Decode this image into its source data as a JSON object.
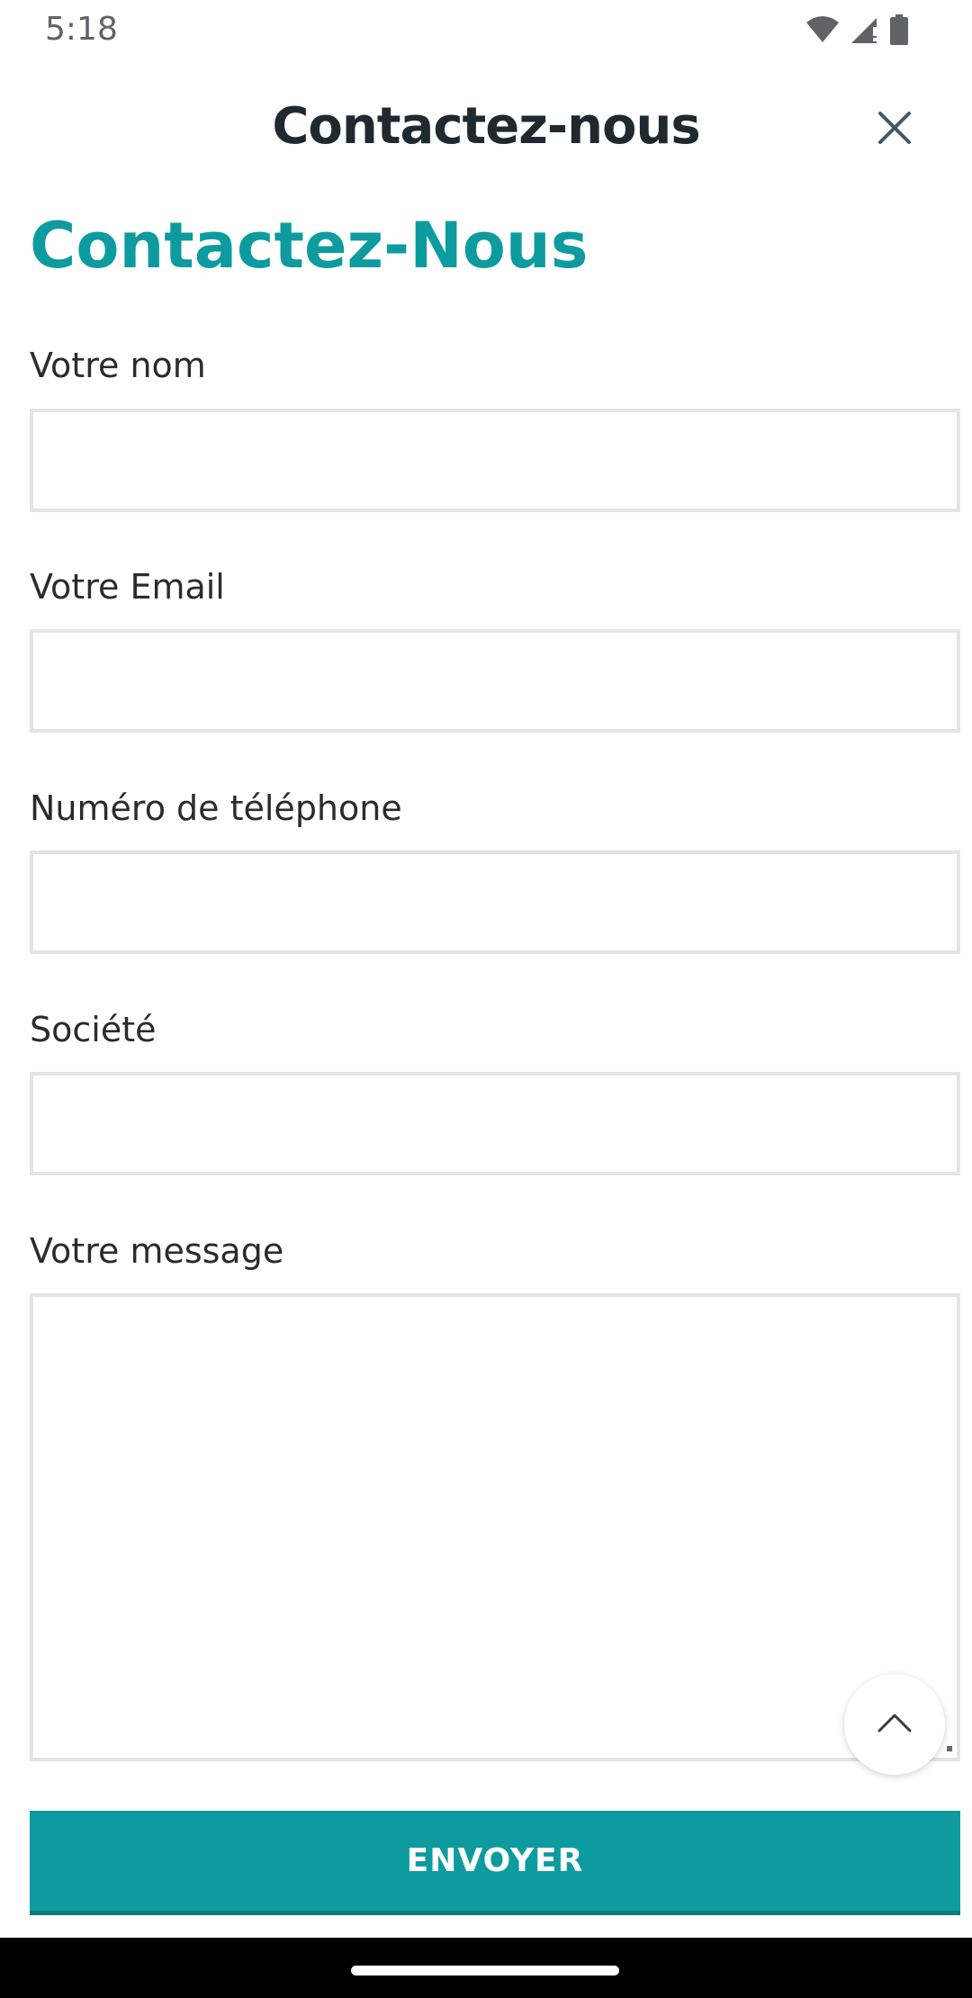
{
  "status_bar": {
    "time": "5:18",
    "icons": [
      "wifi-icon",
      "signal-icon",
      "battery-icon"
    ]
  },
  "header": {
    "title": "Contactez-nous",
    "close_icon": "close-icon"
  },
  "page": {
    "heading": "Contactez-Nous"
  },
  "form": {
    "fields": [
      {
        "label": "Votre nom",
        "value": ""
      },
      {
        "label": "Votre Email",
        "value": ""
      },
      {
        "label": "Numéro de téléphone",
        "value": ""
      },
      {
        "label": "Société",
        "value": ""
      },
      {
        "label": "Votre message",
        "value": ""
      }
    ],
    "submit_label": "ENVOYER"
  },
  "colors": {
    "accent": "#0d9ba0",
    "header_text": "#1f2a30",
    "input_border": "#e4e4e4"
  },
  "scroll_top_icon": "chevron-up-icon"
}
